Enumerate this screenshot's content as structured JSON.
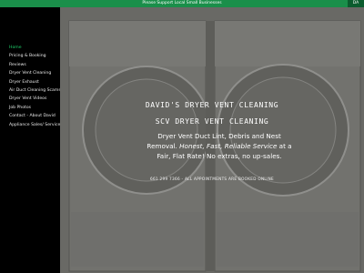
{
  "topbar": {
    "message": "Please Support Local Small Businesses",
    "corner_label": "DA"
  },
  "nav": [
    "Home",
    "Pricing & Booking",
    "Reviews",
    "Dryer Vent Cleaning",
    "Dryer Exhaust",
    "Air Duct Cleaning Scams",
    "Dryer Vent Videos",
    "Job Photos",
    "Contact - About David",
    "Appliance Sales/ Service"
  ],
  "hero": {
    "title": "DAVID'S DRYER VENT CLEANING",
    "subtitle": "SCV DRYER VENT CLEANING",
    "blurb_plain": "Dryer Vent Duct Lint, Debris and Nest Removal.",
    "blurb_italic": "Honest, Fast, Reliable Service",
    "blurb_tail": "at a Fair, Flat Rate! No extras, no up-sales.",
    "contact": "661 299 7366 - ALL APPOINTMENTS ARE BOOKED ONLINE"
  },
  "colors": {
    "topbar": "#1a8f4a",
    "active_nav": "#1fd36b",
    "sidebar": "#000000"
  }
}
